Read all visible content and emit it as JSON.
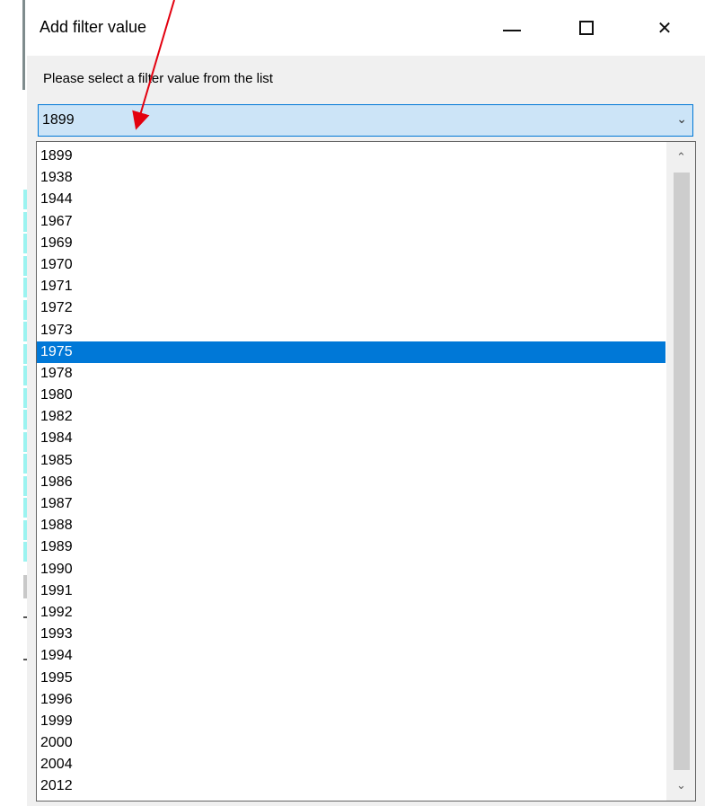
{
  "dialog": {
    "title": "Add filter value",
    "prompt": "Please select a filter value from the list",
    "controls": {
      "minimize": "—",
      "maximize": "☐",
      "close": "✕"
    }
  },
  "combo": {
    "value": "1899",
    "arrow": "⌄"
  },
  "list": {
    "items": [
      "1899",
      "1938",
      "1944",
      "1967",
      "1969",
      "1970",
      "1971",
      "1972",
      "1973",
      "1975",
      "1978",
      "1980",
      "1982",
      "1984",
      "1985",
      "1986",
      "1987",
      "1988",
      "1989",
      "1990",
      "1991",
      "1992",
      "1993",
      "1994",
      "1995",
      "1996",
      "1999",
      "2000",
      "2004",
      "2012"
    ],
    "selected": "1975"
  },
  "scrollbar": {
    "up": "⌃",
    "down": "⌄"
  },
  "colors": {
    "selection": "#0078d7",
    "annotation_arrow": "#e3000f"
  }
}
